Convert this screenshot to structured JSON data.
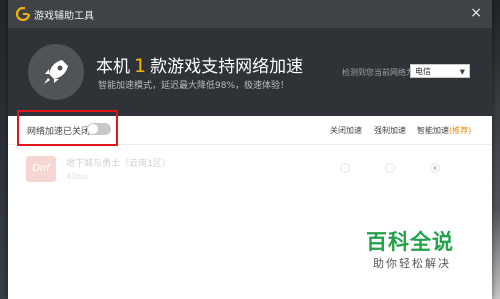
{
  "window": {
    "title": "游戏辅助工具",
    "close": "×"
  },
  "header": {
    "headline_prefix": "本机",
    "count": "1",
    "headline_suffix": "款游戏支持网络加速",
    "subtitle": "智能加速模式，延迟最大降低98%，极速体验！",
    "region_label": "检测到您当前网络为",
    "region_value": "电信"
  },
  "controls": {
    "toggle_label": "网络加速已关闭",
    "toggle_on": false,
    "modes": [
      "关闭加速",
      "强制加速",
      "智能加速"
    ],
    "recommend": "(推荐)"
  },
  "games": [
    {
      "name": "地下城与勇士（云南1区）",
      "ping": "43ms",
      "icon_text": "Dnf",
      "selected_mode": 2
    }
  ],
  "watermark": {
    "main": "百科全说",
    "sub": "助你轻松解决"
  },
  "colors": {
    "accent": "#f5b400",
    "highlight_box": "#e0161b",
    "recommend": "#f08c00",
    "watermark": "#22a24a"
  }
}
